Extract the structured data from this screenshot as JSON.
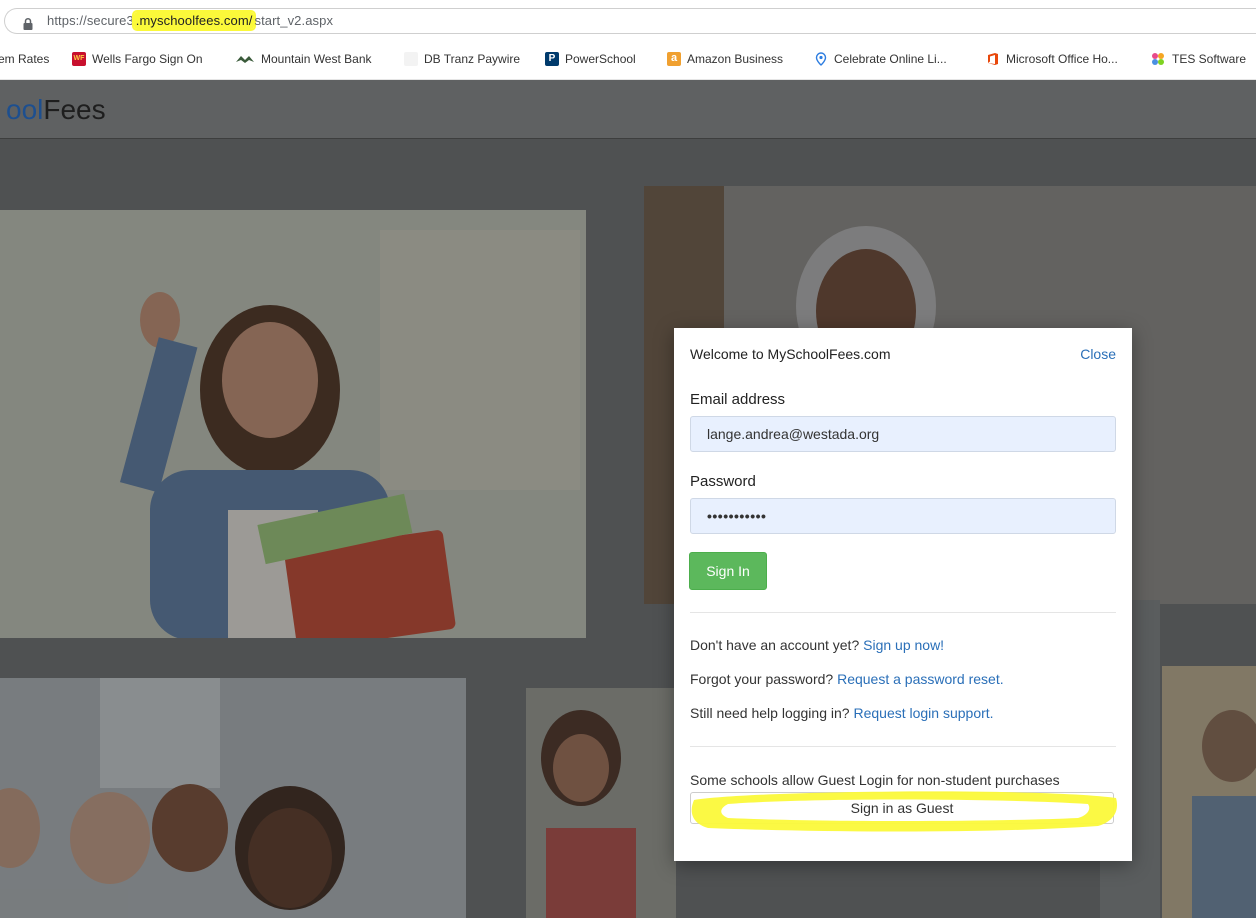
{
  "browser": {
    "url_prefix": "https://secure3",
    "url_highlight": ".myschoolfees.com/",
    "url_suffix": "start_v2.aspx",
    "highlight_color": "#fbf93a"
  },
  "bookmarks": [
    {
      "label": "em Rates",
      "icon": "none"
    },
    {
      "label": "Wells Fargo Sign On",
      "icon": "wells-fargo-icon"
    },
    {
      "label": "Mountain West Bank",
      "icon": "mountain-west-bank-icon"
    },
    {
      "label": "DB Tranz Paywire",
      "icon": "blank-page-icon"
    },
    {
      "label": "PowerSchool",
      "icon": "powerschool-icon"
    },
    {
      "label": "Amazon Business",
      "icon": "amazon-icon"
    },
    {
      "label": "Celebrate Online Li...",
      "icon": "location-pin-icon"
    },
    {
      "label": "Microsoft Office Ho...",
      "icon": "office-icon"
    },
    {
      "label": "TES Software",
      "icon": "tes-icon"
    }
  ],
  "site": {
    "brand_part1": "ool",
    "brand_part2": "Fees"
  },
  "modal": {
    "title": "Welcome to MySchoolFees.com",
    "close_label": "Close",
    "email_label": "Email address",
    "email_value": "lange.andrea@westada.org",
    "password_label": "Password",
    "password_value": "•••••••••••",
    "signin_label": "Sign In",
    "signup_text": "Don't have an account yet?",
    "signup_link": "Sign up now!",
    "forgot_text": "Forgot your password?",
    "forgot_link": "Request a password reset.",
    "help_text": "Still need help logging in?",
    "help_link": "Request login support.",
    "guest_note": "Some schools allow Guest Login for non-student purchases",
    "guest_button": "Sign in as Guest",
    "accent_green": "#5cb85c",
    "link_blue": "#2a6fb8"
  }
}
